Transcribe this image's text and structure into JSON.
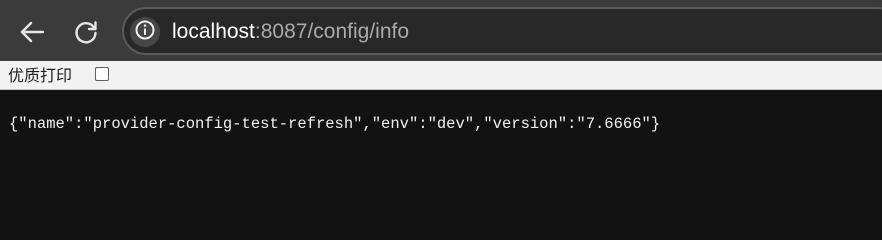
{
  "browser": {
    "nav": {
      "back_icon": "arrow-left-icon",
      "reload_icon": "reload-icon"
    },
    "address_bar": {
      "info_icon": "info-icon",
      "url_host": "localhost",
      "url_rest": ":8087/config/info"
    }
  },
  "pretty_print": {
    "label": "优质打印",
    "checked": false
  },
  "page": {
    "json_text": "{\"name\":\"provider-config-test-refresh\",\"env\":\"dev\",\"version\":\"7.6666\"}"
  },
  "colors": {
    "toolbar_bg": "#3b3b3b",
    "omnibox_bg": "#282828",
    "page_bg": "#121212",
    "url_host": "#ffffff",
    "url_rest": "#a9a9a9"
  }
}
